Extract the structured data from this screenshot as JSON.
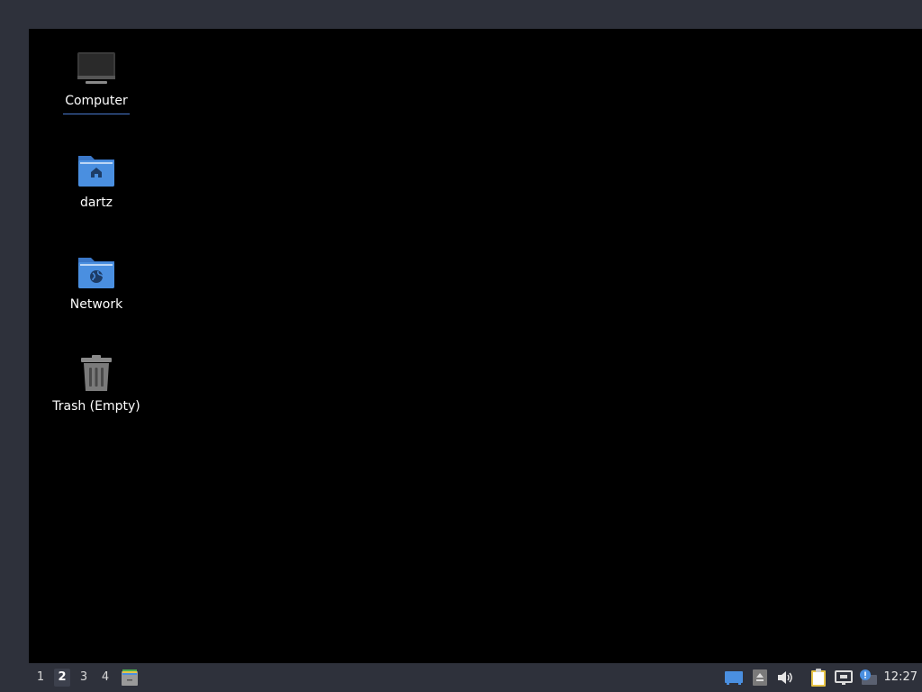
{
  "desktop": {
    "icons": [
      {
        "name": "computer",
        "label": "Computer",
        "icon": "computer-icon"
      },
      {
        "name": "home",
        "label": "dartz",
        "icon": "home-folder-icon"
      },
      {
        "name": "network",
        "label": "Network",
        "icon": "network-folder-icon"
      },
      {
        "name": "trash",
        "label": "Trash (Empty)",
        "icon": "trash-icon"
      }
    ],
    "selected": "Computer"
  },
  "taskbar": {
    "workspaces": [
      "1",
      "2",
      "3",
      "4"
    ],
    "active_workspace": "2",
    "launcher_icon": "file-manager-icon",
    "tray_icons": [
      "show-desktop-icon",
      "eject-icon",
      "volume-icon",
      "clipboard-icon",
      "network-wired-icon",
      "update-notifier-icon"
    ],
    "clock": "12:27"
  },
  "colors": {
    "frame": "#2e313b",
    "desktop": "#000000",
    "folder_blue": "#4a8fe0",
    "selection_underline": "#4a7bd0"
  }
}
